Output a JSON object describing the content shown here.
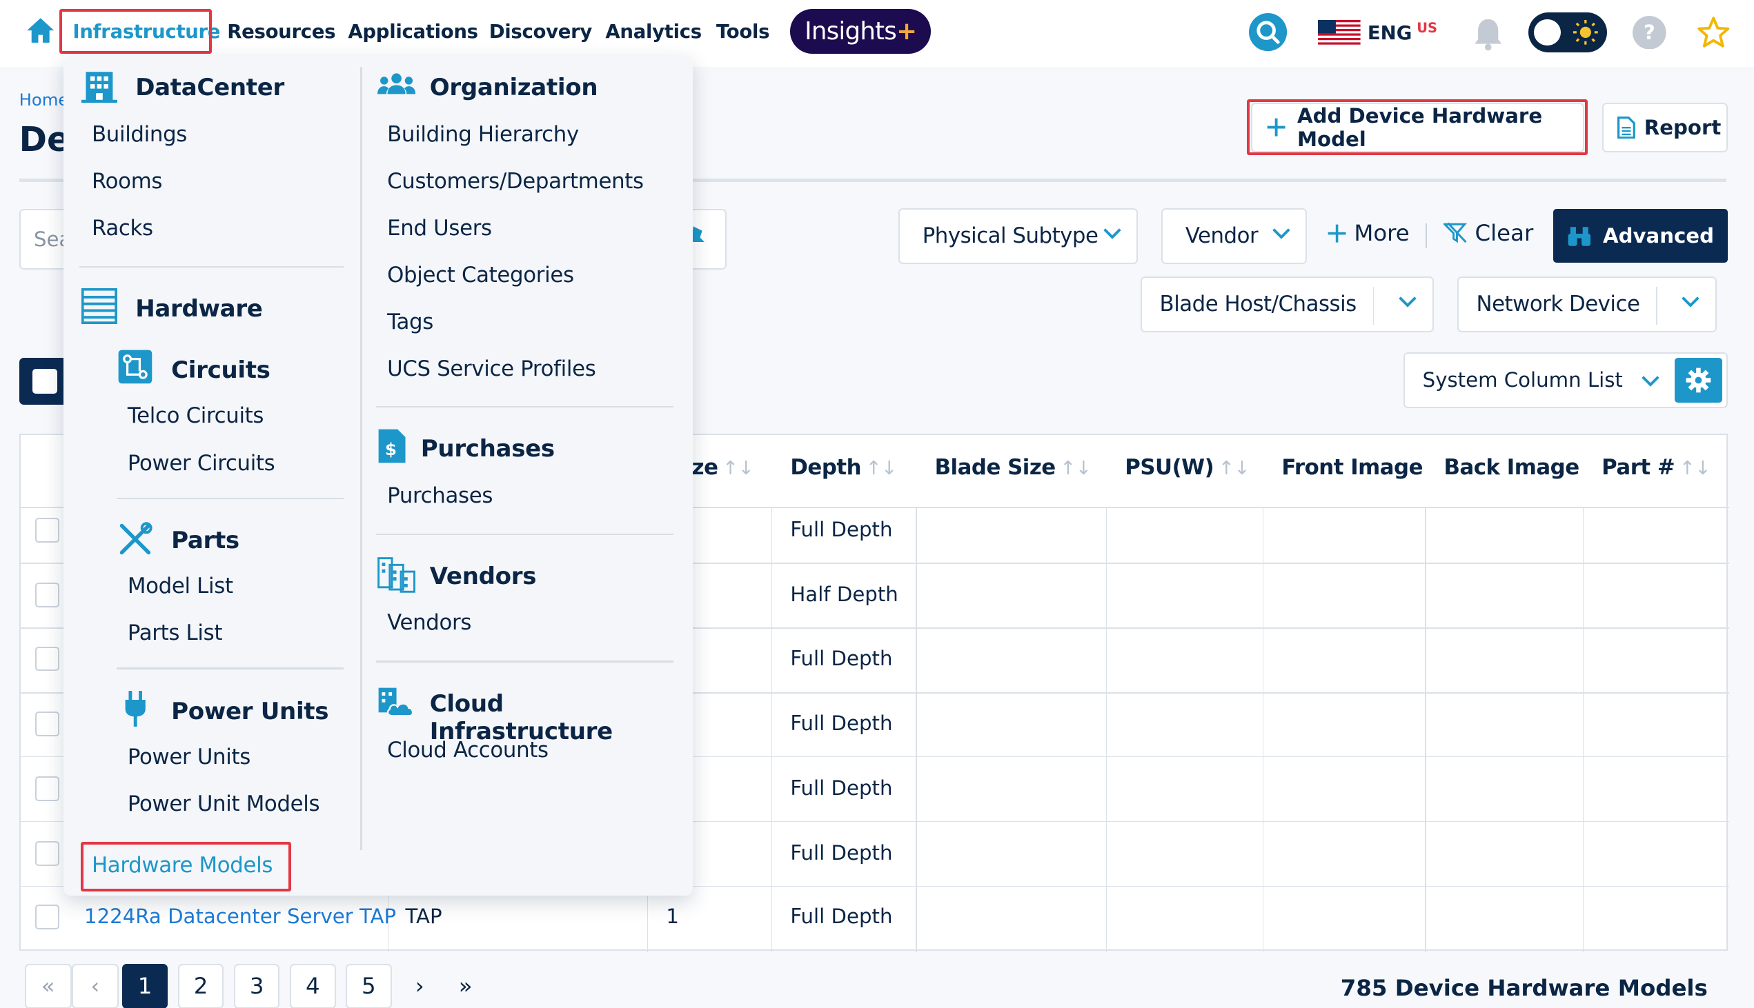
{
  "topnav": {
    "items": [
      "Infrastructure",
      "Resources",
      "Applications",
      "Discovery",
      "Analytics",
      "Tools"
    ],
    "insights_label": "Insights",
    "insights_plus": "+",
    "language": "ENG",
    "language_region": "US"
  },
  "page": {
    "breadcrumb": "Home",
    "title": "De",
    "add_button": "Add Device Hardware Model",
    "report_button": "Report",
    "search_placeholder": "Sea"
  },
  "filters": {
    "physical_subtype": "Physical Subtype",
    "vendor": "Vendor",
    "more": "More",
    "clear": "Clear",
    "advanced": "Advanced",
    "blade_host": "Blade Host/Chassis",
    "network_device": "Network Device",
    "column_list": "System Column List"
  },
  "table": {
    "headers": [
      "ze",
      "Depth",
      "Blade Size",
      "PSU(W)",
      "Front Image",
      "Back Image",
      "Part #"
    ],
    "depths": [
      "Full Depth",
      "Half Depth",
      "Full Depth",
      "Full Depth",
      "Full Depth",
      "Full Depth",
      "Full Depth"
    ],
    "last_row": {
      "name": "1224Ra Datacenter Server TAP",
      "type": "TAP",
      "size": "1",
      "depth": "Full Depth"
    }
  },
  "pagination": {
    "first": "«",
    "prev": "‹",
    "pages": [
      "1",
      "2",
      "3",
      "4",
      "5"
    ],
    "next": "›",
    "last": "»",
    "total": "785 Device Hardware Models"
  },
  "menu": {
    "datacenter": {
      "title": "DataCenter",
      "items": [
        "Buildings",
        "Rooms",
        "Racks"
      ]
    },
    "hardware": {
      "title": "Hardware"
    },
    "circuits": {
      "title": "Circuits",
      "items": [
        "Telco Circuits",
        "Power Circuits"
      ]
    },
    "parts": {
      "title": "Parts",
      "items": [
        "Model List",
        "Parts List"
      ]
    },
    "power_units": {
      "title": "Power Units",
      "items": [
        "Power Units",
        "Power Unit Models"
      ]
    },
    "hardware_models": "Hardware Models",
    "organization": {
      "title": "Organization",
      "items": [
        "Building Hierarchy",
        "Customers/Departments",
        "End Users",
        "Object Categories",
        "Tags",
        "UCS Service Profiles"
      ]
    },
    "purchases": {
      "title": "Purchases",
      "items": [
        "Purchases"
      ]
    },
    "vendors": {
      "title": "Vendors",
      "items": [
        "Vendors"
      ]
    },
    "cloud": {
      "title": "Cloud Infrastructure",
      "items": [
        "Cloud Accounts"
      ]
    }
  },
  "colors": {
    "accent": "#1d97c9",
    "navy": "#0b2a52",
    "highlight_box": "#e23744",
    "insights_bg": "#1c0b4f"
  }
}
